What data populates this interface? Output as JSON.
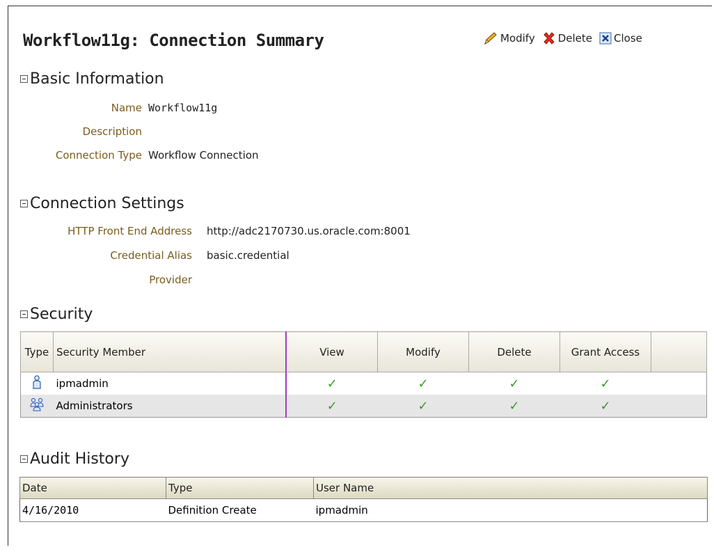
{
  "header": {
    "title": "Workflow11g: Connection Summary"
  },
  "toolbar": {
    "modify": "Modify",
    "delete": "Delete",
    "close": "Close"
  },
  "basic": {
    "heading": "Basic Information",
    "name_label": "Name",
    "name_value": "Workflow11g",
    "description_label": "Description",
    "description_value": "",
    "type_label": "Connection Type",
    "type_value": "Workflow Connection"
  },
  "connection": {
    "heading": "Connection Settings",
    "http_label": "HTTP Front End Address",
    "http_value": "http://adc2170730.us.oracle.com:8001",
    "alias_label": "Credential Alias",
    "alias_value": "basic.credential",
    "provider_label": "Provider",
    "provider_value": ""
  },
  "security": {
    "heading": "Security",
    "columns": [
      "Type",
      "Security Member",
      "View",
      "Modify",
      "Delete",
      "Grant Access"
    ],
    "rows": [
      {
        "icon": "user-icon",
        "member": "ipmadmin",
        "check": "✓"
      },
      {
        "icon": "group-icon",
        "member": "Administrators",
        "check": "✓"
      }
    ]
  },
  "audit": {
    "heading": "Audit History",
    "columns": [
      "Date",
      "Type",
      "User Name"
    ],
    "rows": [
      {
        "date": "4/16/2010",
        "type": "Definition Create",
        "user": "ipmadmin"
      }
    ]
  },
  "colors": {
    "label": "#7a5c1e",
    "check": "#3a9a2a",
    "divider": "#a040c0"
  }
}
